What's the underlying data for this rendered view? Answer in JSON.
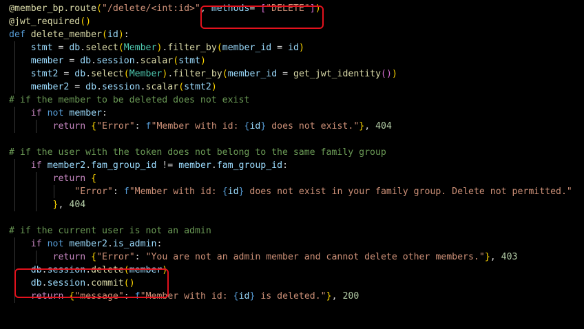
{
  "editor": {
    "language": "python",
    "background": "#000000",
    "highlight_color": "#e3121d",
    "lines": [
      {
        "tokens": [
          [
            "dec",
            "@member_bp.route"
          ],
          [
            "br1",
            "("
          ],
          [
            "str",
            "\"/delete/<int:id>\""
          ],
          [
            "plain",
            ", "
          ],
          [
            "var",
            "methods"
          ],
          [
            "plain",
            "= "
          ],
          [
            "br2",
            "["
          ],
          [
            "str",
            "\"DELETE\""
          ],
          [
            "br2",
            "]"
          ],
          [
            "br1",
            ")"
          ]
        ]
      },
      {
        "tokens": [
          [
            "dec",
            "@jwt_required"
          ],
          [
            "br1",
            "()"
          ]
        ]
      },
      {
        "tokens": [
          [
            "kw",
            "def"
          ],
          [
            "plain",
            " "
          ],
          [
            "fn",
            "delete_member"
          ],
          [
            "br1",
            "("
          ],
          [
            "var",
            "id"
          ],
          [
            "br1",
            ")"
          ],
          [
            "plain",
            ":"
          ]
        ]
      },
      {
        "tokens": [
          [
            "plain",
            "    "
          ],
          [
            "var",
            "stmt"
          ],
          [
            "plain",
            " = "
          ],
          [
            "var",
            "db"
          ],
          [
            "plain",
            "."
          ],
          [
            "fn",
            "select"
          ],
          [
            "br1",
            "("
          ],
          [
            "cls",
            "Member"
          ],
          [
            "br1",
            ")"
          ],
          [
            "plain",
            "."
          ],
          [
            "fn",
            "filter_by"
          ],
          [
            "br1",
            "("
          ],
          [
            "var",
            "member_id"
          ],
          [
            "plain",
            " = "
          ],
          [
            "var",
            "id"
          ],
          [
            "br1",
            ")"
          ]
        ]
      },
      {
        "tokens": [
          [
            "plain",
            "    "
          ],
          [
            "var",
            "member"
          ],
          [
            "plain",
            " = "
          ],
          [
            "var",
            "db"
          ],
          [
            "plain",
            "."
          ],
          [
            "var",
            "session"
          ],
          [
            "plain",
            "."
          ],
          [
            "fn",
            "scalar"
          ],
          [
            "br1",
            "("
          ],
          [
            "var",
            "stmt"
          ],
          [
            "br1",
            ")"
          ]
        ]
      },
      {
        "tokens": [
          [
            "plain",
            "    "
          ],
          [
            "var",
            "stmt2"
          ],
          [
            "plain",
            " = "
          ],
          [
            "var",
            "db"
          ],
          [
            "plain",
            "."
          ],
          [
            "fn",
            "select"
          ],
          [
            "br1",
            "("
          ],
          [
            "cls",
            "Member"
          ],
          [
            "br1",
            ")"
          ],
          [
            "plain",
            "."
          ],
          [
            "fn",
            "filter_by"
          ],
          [
            "br1",
            "("
          ],
          [
            "var",
            "member_id"
          ],
          [
            "plain",
            " = "
          ],
          [
            "fn",
            "get_jwt_identity"
          ],
          [
            "br2",
            "()"
          ],
          [
            "br1",
            ")"
          ]
        ]
      },
      {
        "tokens": [
          [
            "plain",
            "    "
          ],
          [
            "var",
            "member2"
          ],
          [
            "plain",
            " = "
          ],
          [
            "var",
            "db"
          ],
          [
            "plain",
            "."
          ],
          [
            "var",
            "session"
          ],
          [
            "plain",
            "."
          ],
          [
            "fn",
            "scalar"
          ],
          [
            "br1",
            "("
          ],
          [
            "var",
            "stmt2"
          ],
          [
            "br1",
            ")"
          ]
        ]
      },
      {
        "tokens": [
          [
            "cmt",
            "# if the member to be deleted does not exist"
          ]
        ]
      },
      {
        "tokens": [
          [
            "plain",
            "    "
          ],
          [
            "ctrl",
            "if"
          ],
          [
            "plain",
            " "
          ],
          [
            "kw",
            "not"
          ],
          [
            "plain",
            " "
          ],
          [
            "var",
            "member"
          ],
          [
            "plain",
            ":"
          ]
        ]
      },
      {
        "tokens": [
          [
            "plain",
            "        "
          ],
          [
            "ctrl",
            "return"
          ],
          [
            "plain",
            " "
          ],
          [
            "br1",
            "{"
          ],
          [
            "str",
            "\"Error\""
          ],
          [
            "plain",
            ": "
          ],
          [
            "kw",
            "f"
          ],
          [
            "str",
            "\"Member with id: "
          ],
          [
            "kw",
            "{"
          ],
          [
            "var",
            "id"
          ],
          [
            "kw",
            "}"
          ],
          [
            "str",
            " does not exist.\""
          ],
          [
            "br1",
            "}"
          ],
          [
            "plain",
            ", "
          ],
          [
            "num",
            "404"
          ]
        ]
      },
      {
        "tokens": []
      },
      {
        "tokens": [
          [
            "cmt",
            "# if the user with the token does not belong to the same family group"
          ]
        ]
      },
      {
        "tokens": [
          [
            "plain",
            "    "
          ],
          [
            "ctrl",
            "if"
          ],
          [
            "plain",
            " "
          ],
          [
            "var",
            "member2"
          ],
          [
            "plain",
            "."
          ],
          [
            "var",
            "fam_group_id"
          ],
          [
            "plain",
            " != "
          ],
          [
            "var",
            "member"
          ],
          [
            "plain",
            "."
          ],
          [
            "var",
            "fam_group_id"
          ],
          [
            "plain",
            ":"
          ]
        ]
      },
      {
        "tokens": [
          [
            "plain",
            "        "
          ],
          [
            "ctrl",
            "return"
          ],
          [
            "plain",
            " "
          ],
          [
            "br1",
            "{"
          ]
        ]
      },
      {
        "tokens": [
          [
            "plain",
            "            "
          ],
          [
            "str",
            "\"Error\""
          ],
          [
            "plain",
            ": "
          ],
          [
            "kw",
            "f"
          ],
          [
            "str",
            "\"Member with id: "
          ],
          [
            "kw",
            "{"
          ],
          [
            "var",
            "id"
          ],
          [
            "kw",
            "}"
          ],
          [
            "str",
            " does not exist in your family group. Delete not permitted.\""
          ]
        ]
      },
      {
        "tokens": [
          [
            "plain",
            "        "
          ],
          [
            "br1",
            "}"
          ],
          [
            "plain",
            ", "
          ],
          [
            "num",
            "404"
          ]
        ]
      },
      {
        "tokens": []
      },
      {
        "tokens": [
          [
            "cmt",
            "# if the current user is not an admin"
          ]
        ]
      },
      {
        "tokens": [
          [
            "plain",
            "    "
          ],
          [
            "ctrl",
            "if"
          ],
          [
            "plain",
            " "
          ],
          [
            "kw",
            "not"
          ],
          [
            "plain",
            " "
          ],
          [
            "var",
            "member2"
          ],
          [
            "plain",
            "."
          ],
          [
            "var",
            "is_admin"
          ],
          [
            "plain",
            ":"
          ]
        ]
      },
      {
        "tokens": [
          [
            "plain",
            "        "
          ],
          [
            "ctrl",
            "return"
          ],
          [
            "plain",
            " "
          ],
          [
            "br1",
            "{"
          ],
          [
            "str",
            "\"Error\""
          ],
          [
            "plain",
            ": "
          ],
          [
            "str",
            "\"You are not an admin member and cannot delete other members.\""
          ],
          [
            "br1",
            "}"
          ],
          [
            "plain",
            ", "
          ],
          [
            "num",
            "403"
          ]
        ]
      },
      {
        "tokens": [
          [
            "plain",
            "    "
          ],
          [
            "var",
            "db"
          ],
          [
            "plain",
            "."
          ],
          [
            "var",
            "session"
          ],
          [
            "plain",
            "."
          ],
          [
            "fn",
            "delete"
          ],
          [
            "br1",
            "("
          ],
          [
            "var",
            "member"
          ],
          [
            "br1",
            ")"
          ]
        ]
      },
      {
        "tokens": [
          [
            "plain",
            "    "
          ],
          [
            "var",
            "db"
          ],
          [
            "plain",
            "."
          ],
          [
            "var",
            "session"
          ],
          [
            "plain",
            "."
          ],
          [
            "fn",
            "commit"
          ],
          [
            "br1",
            "()"
          ]
        ]
      },
      {
        "tokens": [
          [
            "plain",
            "    "
          ],
          [
            "ctrl",
            "return"
          ],
          [
            "plain",
            " "
          ],
          [
            "br1",
            "{"
          ],
          [
            "str",
            "\"message\""
          ],
          [
            "plain",
            ": "
          ],
          [
            "kw",
            "f"
          ],
          [
            "str",
            "\"Member with id: "
          ],
          [
            "kw",
            "{"
          ],
          [
            "var",
            "id"
          ],
          [
            "kw",
            "}"
          ],
          [
            "str",
            " is deleted.\""
          ],
          [
            "br1",
            "}"
          ],
          [
            "plain",
            ", "
          ],
          [
            "num",
            "200"
          ]
        ]
      }
    ]
  }
}
